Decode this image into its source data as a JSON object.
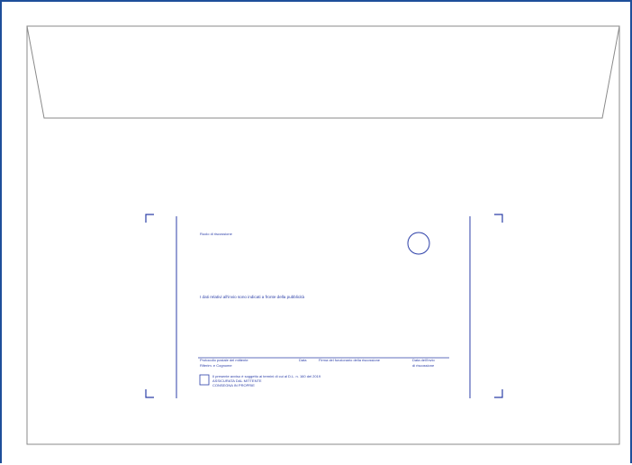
{
  "colors": {
    "frame_border": "#1e4f9a",
    "envelope_outline": "#8a8a8a",
    "print_blue": "#2c3fa8",
    "background": "#ffffff"
  },
  "envelope": {
    "address_window": {
      "header_text": "Ruolo di riscossione",
      "notice_text": "I dati relativi all'invio sono indicati a fronte della pubblicità",
      "footer_labels": [
        "Protocollo postale del mittente",
        "Data",
        "Firma del funzionario della riscossione",
        "Data dell'invio"
      ],
      "footer_labels_line2": [
        "Riferim. e Cognome",
        "di riscossione"
      ],
      "checkbox_text_line1": "Il presente avviso è soggetto ai termini di cui al D.L. n. 160 del 2019",
      "checkbox_text_line2": "ASSICURATA DAL MITTENTE",
      "checkbox_text_line3": "CONSEGNA IN PROPRIE"
    }
  }
}
